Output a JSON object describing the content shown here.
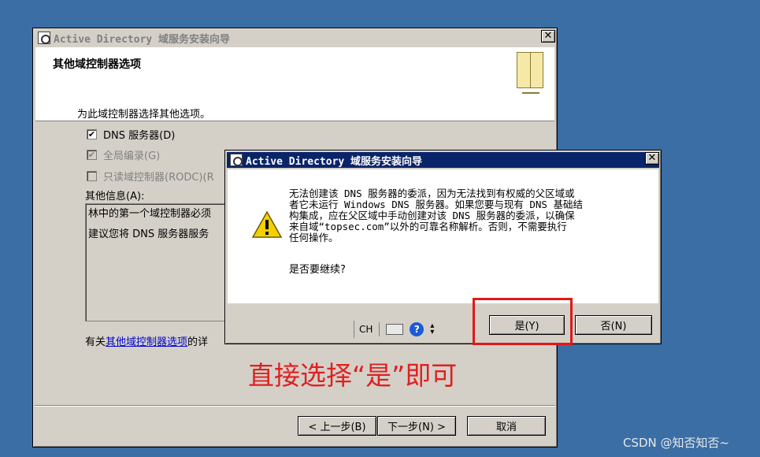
{
  "wizard": {
    "title": "Active Directory 域服务安装向导",
    "header_title": "其他域控制器选项",
    "intro": "为此域控制器选择其他选项。",
    "options": [
      {
        "label": "DNS 服务器(D)",
        "checked": true,
        "enabled": true
      },
      {
        "label": "全局编录(G)",
        "checked": true,
        "enabled": false
      },
      {
        "label": "只读域控制器(RODC)(R",
        "checked": false,
        "enabled": false
      }
    ],
    "info_label": "其他信息(A):",
    "info_lines": [
      "林中的第一个域控制器必须",
      "建议您将 DNS 服务器服务"
    ],
    "more_prefix": "有关",
    "more_link": "其他域控制器选项",
    "more_suffix": "的详",
    "buttons": {
      "back": "< 上一步(B)",
      "next": "下一步(N) >",
      "cancel": "取消"
    }
  },
  "dialog": {
    "title": "Active Directory 域服务安装向导",
    "message_lines": [
      "无法创建该 DNS 服务器的委派，因为无法找到有权威的父区域或",
      "者它未运行 Windows DNS 服务器。如果您要与现有 DNS 基础结",
      "构集成，应在父区域中手动创建对该 DNS 服务器的委派，以确保",
      "来自域“topsec.com”以外的可靠名称解析。否则，不需要执行",
      "任何操作。"
    ],
    "question": "是否要继续?",
    "yes": "是(Y)",
    "no": "否(N)",
    "tray_lang": "CH"
  },
  "annotation": "直接选择“是”即可",
  "watermark": "CSDN @知否知否~",
  "colors": {
    "desktop": "#3a6ea5",
    "active_title": "#0a246a",
    "annotation": "#e02020"
  }
}
